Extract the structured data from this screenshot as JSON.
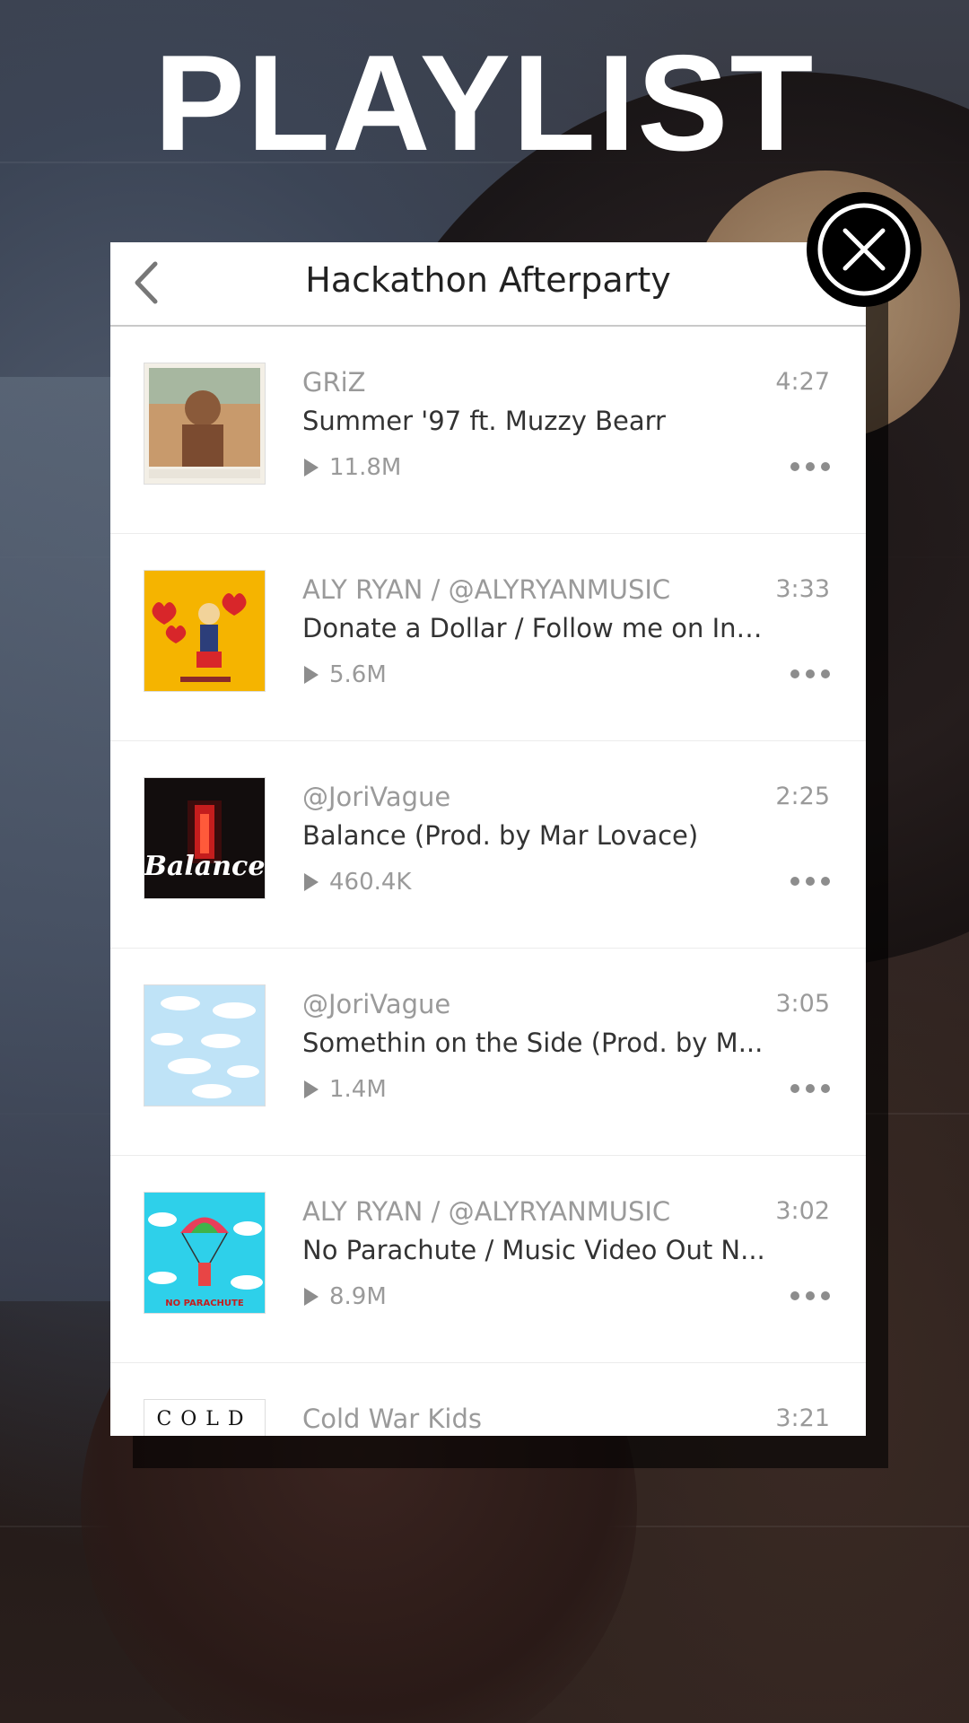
{
  "page_title": "PLAYLIST",
  "playlist": {
    "name": "Hackathon Afterparty",
    "back_icon": "chevron-left-icon",
    "close_icon": "close-icon"
  },
  "tracks": [
    {
      "artist": "GRiZ",
      "title": "Summer '97 ft. Muzzy Bearr",
      "plays": "11.8M",
      "duration": "4:27",
      "art_caption": "GRiZ - Summer '97 ft. Muzzy Bearr"
    },
    {
      "artist": "ALY RYAN / @ALYRYANMUSIC",
      "title": "Donate a Dollar / Follow me on Inst...",
      "plays": "5.6M",
      "duration": "3:33",
      "art_caption": "Donate a Dollar"
    },
    {
      "artist": "@JoriVague",
      "title": "Balance (Prod. by Mar Lovace)",
      "plays": "460.4K",
      "duration": "2:25",
      "art_caption": "Balance"
    },
    {
      "artist": "@JoriVague",
      "title": "Somethin on the Side (Prod. by M...",
      "plays": "1.4M",
      "duration": "3:05",
      "art_caption": ""
    },
    {
      "artist": "ALY RYAN / @ALYRYANMUSIC",
      "title": "No Parachute / Music Video Out N...",
      "plays": "8.9M",
      "duration": "3:02",
      "art_caption": "NO PARACHUTE"
    },
    {
      "artist": "Cold War Kids",
      "title": "",
      "plays": "",
      "duration": "3:21",
      "art_caption": "COLD"
    }
  ]
}
